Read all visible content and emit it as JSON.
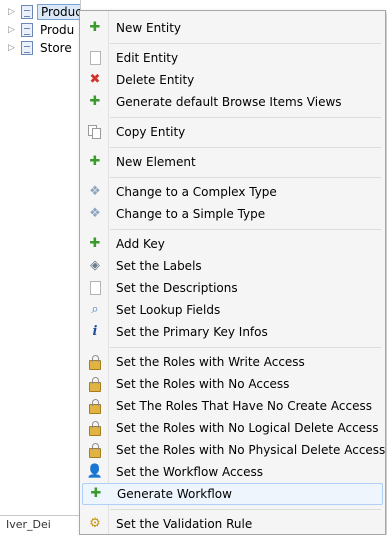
{
  "tree": {
    "items": [
      {
        "label": "Product",
        "selected": true
      },
      {
        "label": "Produ",
        "selected": false
      },
      {
        "label": "Store",
        "selected": false
      }
    ]
  },
  "status": {
    "text": "Iver_Dei"
  },
  "menu": {
    "new_entity": "New Entity",
    "edit_entity": "Edit Entity",
    "delete_entity": "Delete Entity",
    "generate_views": "Generate default Browse Items Views",
    "copy_entity": "Copy Entity",
    "new_element": "New Element",
    "change_complex": "Change to a Complex Type",
    "change_simple": "Change to a Simple Type",
    "add_key": "Add Key",
    "set_labels": "Set the Labels",
    "set_descriptions": "Set the Descriptions",
    "set_lookup": "Set Lookup Fields",
    "set_pk_infos": "Set the Primary Key Infos",
    "roles_write": "Set the Roles with Write Access",
    "roles_no_access": "Set the Roles with No Access",
    "roles_no_create": "Set The Roles That Have No Create Access",
    "roles_no_logical_delete": "Set the Roles with No Logical Delete Access",
    "roles_no_physical_delete": "Set the Roles with No Physical Delete Access",
    "workflow_access": "Set the Workflow Access",
    "generate_workflow": "Generate Workflow",
    "validation_rule": "Set the Validation Rule"
  },
  "colors": {
    "accent_plus": "#3a9a2c",
    "delete_red": "#d0342c",
    "hover_bg": "#eef5fd"
  }
}
